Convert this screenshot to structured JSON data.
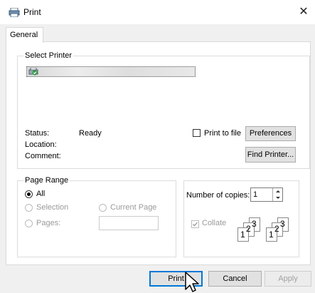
{
  "window": {
    "title": "Print",
    "close_glyph": "✕"
  },
  "tabs": [
    {
      "label": "General"
    }
  ],
  "select_printer": {
    "group_title": "Select Printer"
  },
  "status": {
    "status_label": "Status:",
    "status_value": "Ready",
    "location_label": "Location:",
    "comment_label": "Comment:"
  },
  "print_to_file": {
    "label": "Print to file",
    "checked": false
  },
  "buttons": {
    "preferences": "Preferences",
    "find_printer": "Find Printer...",
    "print": "Print",
    "cancel": "Cancel",
    "apply": "Apply"
  },
  "page_range": {
    "group_title": "Page Range",
    "all": "All",
    "selection": "Selection",
    "current_page": "Current Page",
    "pages": "Pages:",
    "selected": "All"
  },
  "copies": {
    "label": "Number of copies:",
    "value": "1",
    "collate_label": "Collate",
    "collate_checked": true,
    "collate_digits": [
      "1",
      "2",
      "3"
    ]
  },
  "colors": {
    "accent": "#0078d7",
    "check_green": "#2ea043"
  }
}
